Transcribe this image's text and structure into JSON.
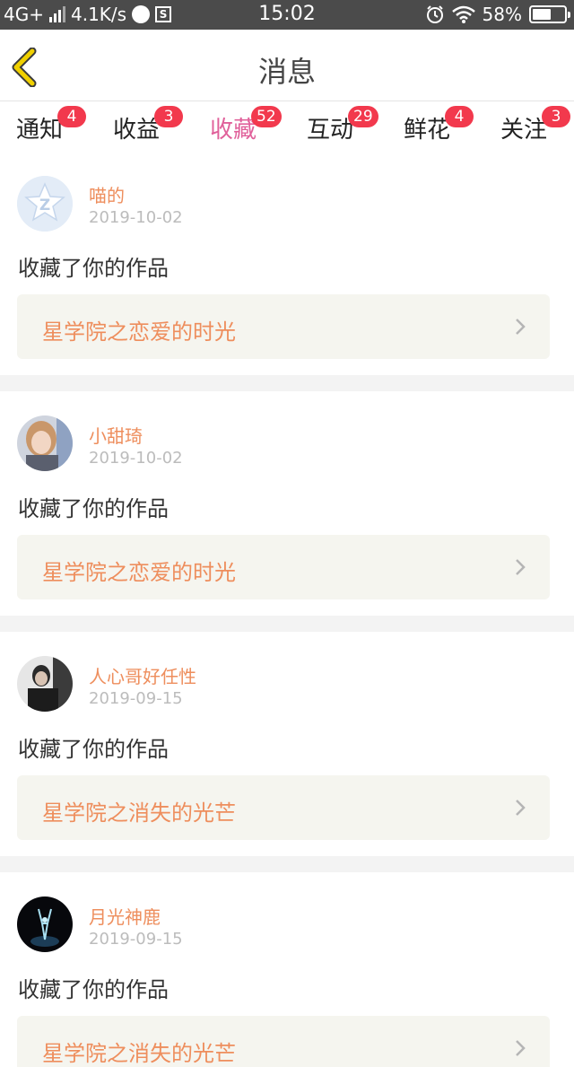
{
  "status_bar": {
    "network": "4G+",
    "speed": "4.1K/s",
    "sim_icon": "S",
    "time": "15:02",
    "battery_percent": "58%",
    "battery_level": 0.58
  },
  "header": {
    "title": "消息",
    "accent": "#f0d000"
  },
  "tabs": [
    {
      "label": "通知",
      "badge": "4"
    },
    {
      "label": "收益",
      "badge": "3"
    },
    {
      "label": "收藏",
      "badge": "52",
      "active": true
    },
    {
      "label": "互动",
      "badge": "29"
    },
    {
      "label": "鲜花",
      "badge": "4"
    },
    {
      "label": "关注",
      "badge": "3"
    }
  ],
  "colors": {
    "active_tab": "#e0609a",
    "badge": "#f2394d",
    "username": "#ee8e5d",
    "work_bg": "#f5f5ef"
  },
  "items": [
    {
      "name": "喵的",
      "date": "2019-10-02",
      "action": "收藏了你的作品",
      "work": "星学院之恋爱的时光",
      "avatar": "qq-default-avatar"
    },
    {
      "name": "小甜琦",
      "date": "2019-10-02",
      "action": "收藏了你的作品",
      "work": "星学院之恋爱的时光",
      "avatar": "photo-avatar-girl"
    },
    {
      "name": "人心哥好任性",
      "date": "2019-09-15",
      "action": "收藏了你的作品",
      "work": "星学院之消失的光芒",
      "avatar": "photo-avatar-man"
    },
    {
      "name": "月光神鹿",
      "date": "2019-09-15",
      "action": "收藏了你的作品",
      "work": "星学院之消失的光芒",
      "avatar": "photo-avatar-dark"
    }
  ]
}
